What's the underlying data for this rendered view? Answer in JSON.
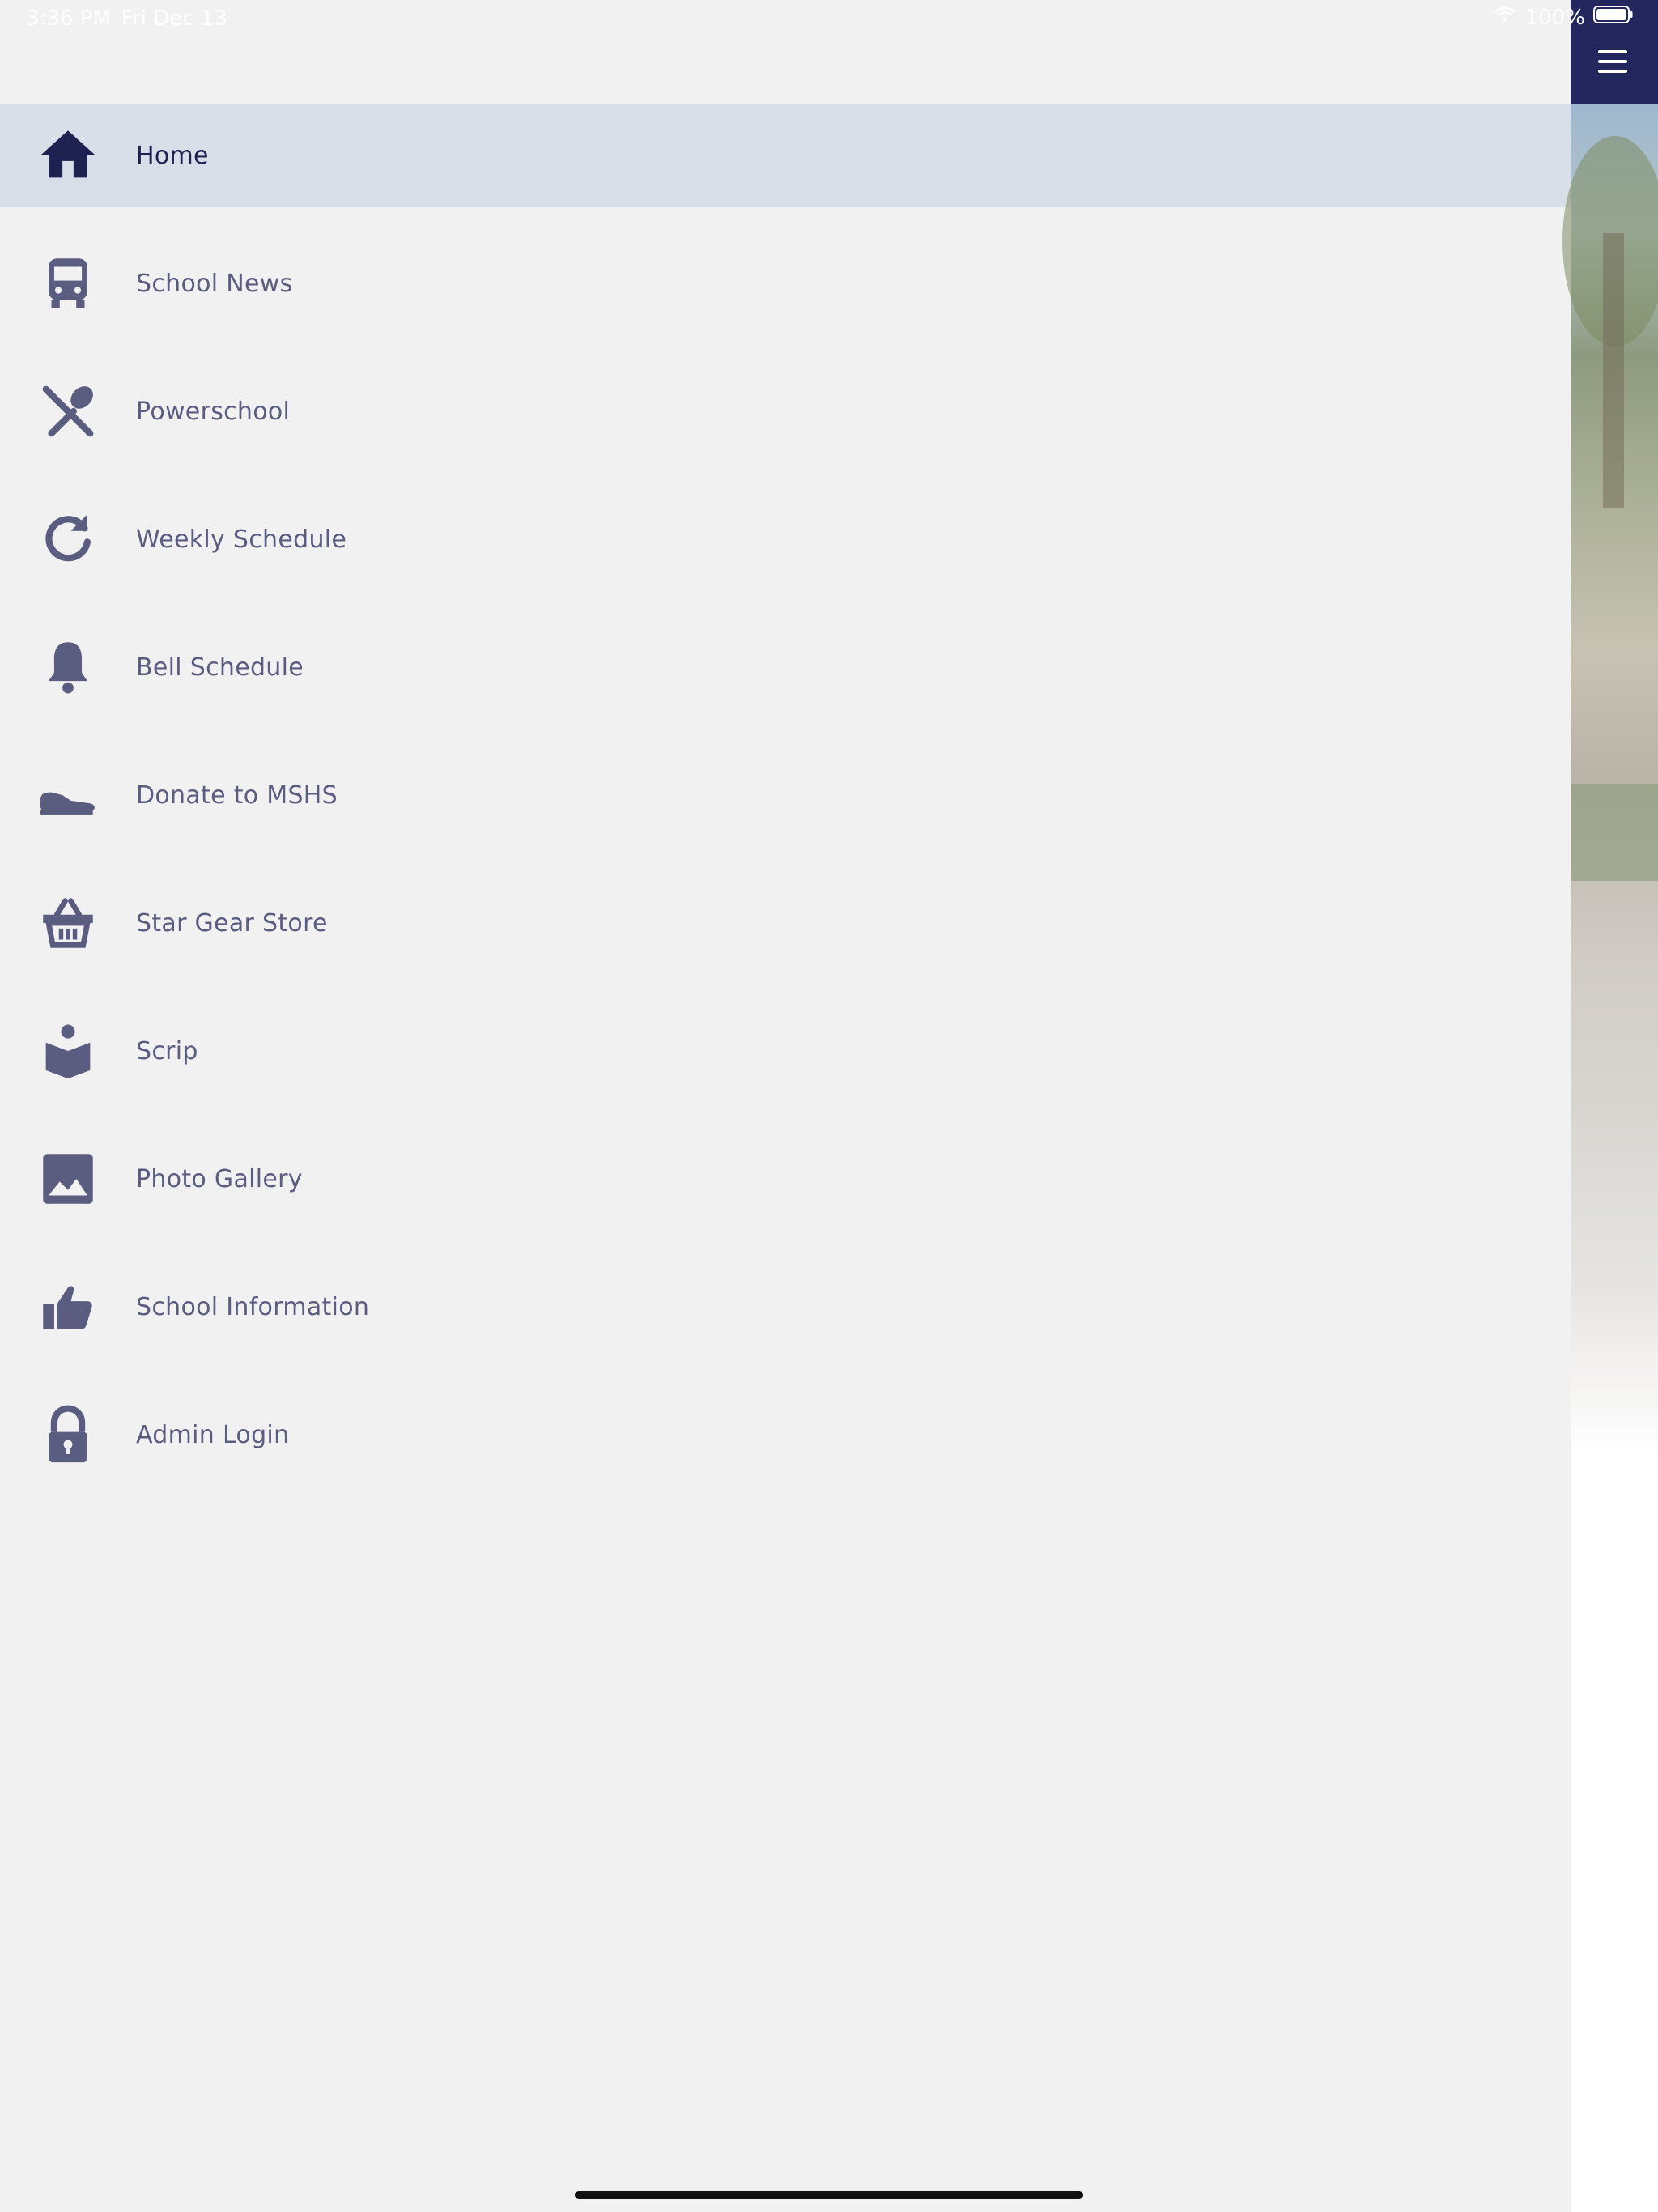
{
  "status_bar": {
    "time": "3:36 PM",
    "date": "Fri Dec 13",
    "battery": "100%"
  },
  "menu": {
    "items": [
      {
        "label": "Home",
        "icon": "home-icon",
        "active": true
      },
      {
        "label": "School News",
        "icon": "bus-icon"
      },
      {
        "label": "Powerschool",
        "icon": "utensils-icon"
      },
      {
        "label": "Weekly Schedule",
        "icon": "refresh-icon"
      },
      {
        "label": "Bell Schedule",
        "icon": "bell-icon"
      },
      {
        "label": "Donate to MSHS",
        "icon": "shoe-icon"
      },
      {
        "label": "Star Gear Store",
        "icon": "basket-icon"
      },
      {
        "label": "Scrip",
        "icon": "reader-icon"
      },
      {
        "label": "Photo Gallery",
        "icon": "image-icon"
      },
      {
        "label": "School Information",
        "icon": "thumbs-up-icon"
      },
      {
        "label": "Admin Login",
        "icon": "lock-icon"
      }
    ]
  },
  "colors": {
    "drawer_bg": "#f2f1f1",
    "active_bg": "#d8dfe9",
    "icon_color": "#5a5c80",
    "active_color": "#1f2251",
    "nav_bar": "#24275d"
  }
}
